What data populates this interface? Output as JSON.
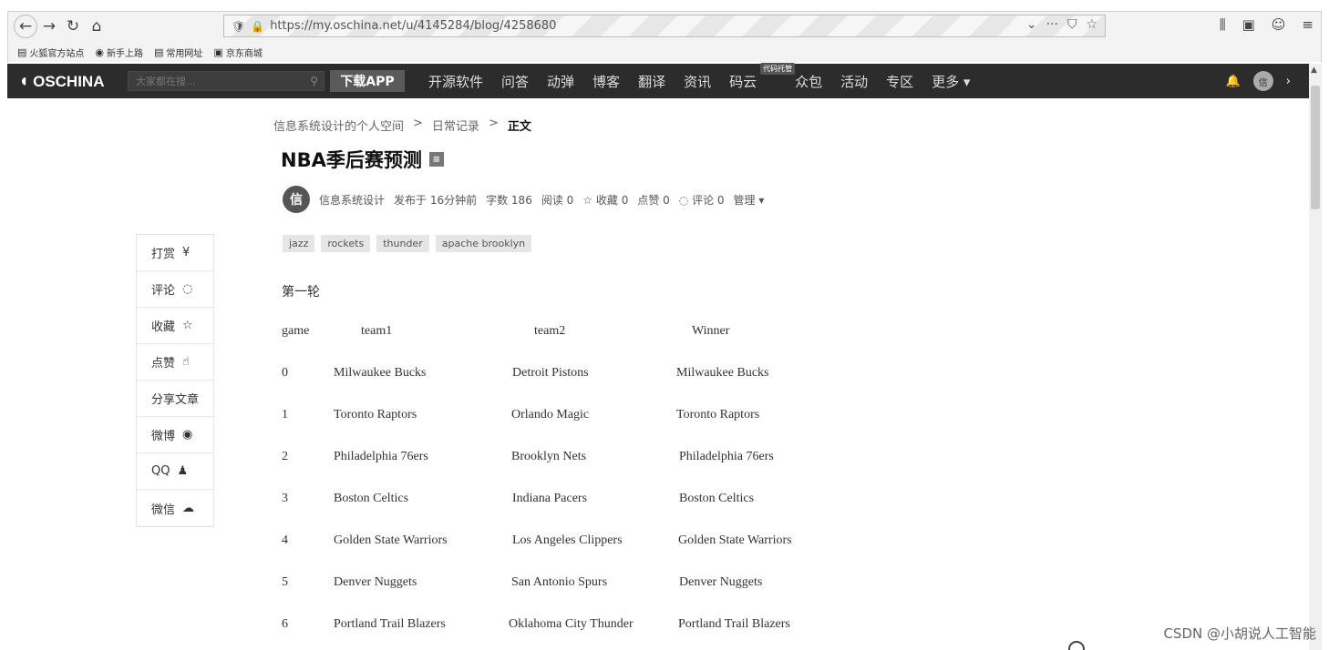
{
  "browser": {
    "url": "https://my.oschina.net/u/4145284/blog/4258680",
    "bookmarks": [
      "火狐官方站点",
      "新手上路",
      "常用网址",
      "京东商城"
    ]
  },
  "header": {
    "logo": "OSCHINA",
    "search_placeholder": "大家都在搜...",
    "download_label": "下载APP",
    "nav_items": [
      "开源软件",
      "问答",
      "动弹",
      "博客",
      "翻译",
      "资讯",
      "码云",
      "众包",
      "活动",
      "专区",
      "更多 ▾"
    ],
    "nav_badge": "代码托管",
    "avatar_text": "信"
  },
  "breadcrumb": [
    "信息系统设计的个人空间",
    "日常记录",
    "正文"
  ],
  "article": {
    "title": "NBA季后赛预测",
    "author_initial": "信",
    "author": "信息系统设计",
    "published": "发布于 16分钟前",
    "word_count": "字数 186",
    "reads": "阅读 0",
    "favorites": "收藏 0",
    "likes": "点赞 0",
    "comments": "评论 0",
    "manage": "管理 ▾",
    "tags": [
      "jazz",
      "rockets",
      "thunder",
      "apache brooklyn"
    ],
    "section": "第一轮",
    "table_header": [
      "game",
      "team1",
      "team2",
      "Winner"
    ],
    "rows": [
      [
        "0",
        "Milwaukee Bucks",
        "Detroit Pistons",
        "Milwaukee Bucks"
      ],
      [
        "1",
        "Toronto Raptors",
        "Orlando Magic",
        "Toronto Raptors"
      ],
      [
        "2",
        "Philadelphia 76ers",
        "Brooklyn Nets",
        "Philadelphia 76ers"
      ],
      [
        "3",
        "Boston Celtics",
        "Indiana Pacers",
        "Boston Celtics"
      ],
      [
        "4",
        "Golden State Warriors",
        "Los Angeles Clippers",
        "Golden State Warriors"
      ],
      [
        "5",
        "Denver Nuggets",
        "San Antonio Spurs",
        "Denver Nuggets"
      ],
      [
        "6",
        "Portland Trail Blazers",
        "Oklahoma City Thunder",
        "Portland Trail Blazers"
      ]
    ]
  },
  "share_bar": [
    {
      "label": "打赏",
      "icon": "¥"
    },
    {
      "label": "评论",
      "icon": "💬"
    },
    {
      "label": "收藏",
      "icon": "☆"
    },
    {
      "label": "点赞",
      "icon": "👍"
    },
    {
      "label": "分享文章",
      "icon": ""
    },
    {
      "label": "微博",
      "icon": "◉"
    },
    {
      "label": "QQ",
      "icon": "♟"
    },
    {
      "label": "微信",
      "icon": "☁"
    }
  ],
  "watermark": "CSDN @小胡说人工智能"
}
